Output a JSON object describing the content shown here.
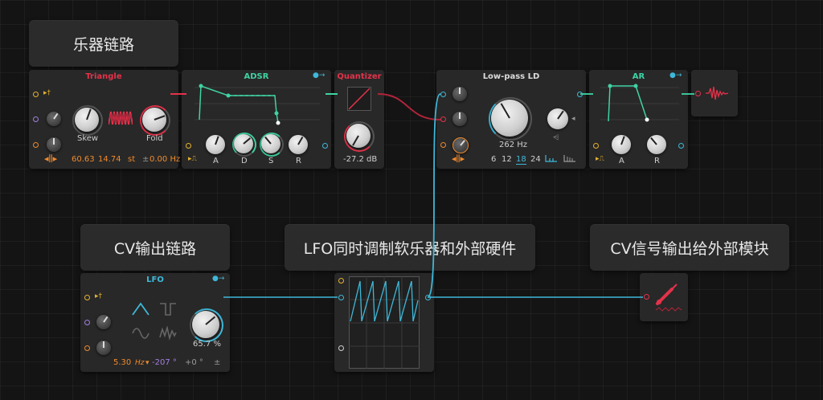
{
  "labels": {
    "instrument_chain": "乐器链路",
    "cv_chain": "CV输出链路",
    "lfo_mod": "LFO同时调制软乐器和外部硬件",
    "cv_signal": "CV信号输出给外部模块"
  },
  "triangle": {
    "title": "Triangle",
    "skew_label": "Skew",
    "fold_label": "Fold",
    "pitch": "60.63",
    "semitones": "14.74",
    "semitone_unit": "st",
    "plusminus": "±",
    "freq": "0.00 Hz"
  },
  "adsr": {
    "title": "ADSR",
    "a": "A",
    "d": "D",
    "s": "S",
    "r": "R"
  },
  "quantizer": {
    "title": "Quantizer",
    "value": "-27.2 dB"
  },
  "lowpass": {
    "title": "Low-pass LD",
    "freq": "262 Hz",
    "slopes": [
      "6",
      "12",
      "18",
      "24"
    ],
    "active_slope": "18"
  },
  "ar": {
    "title": "AR",
    "a": "A",
    "r": "R"
  },
  "lfo": {
    "title": "LFO",
    "amount": "65.7 %",
    "rate": "5.30",
    "rate_unit": "Hz",
    "phase": "-207 °",
    "offset": "+0 °",
    "plusminus": "±"
  },
  "colors": {
    "red": "#e4324a",
    "teal": "#3fd3a4",
    "cyan": "#3fb8d8",
    "orange": "#f08a2c",
    "yellow": "#e5b230",
    "purple": "#a37fe0"
  }
}
